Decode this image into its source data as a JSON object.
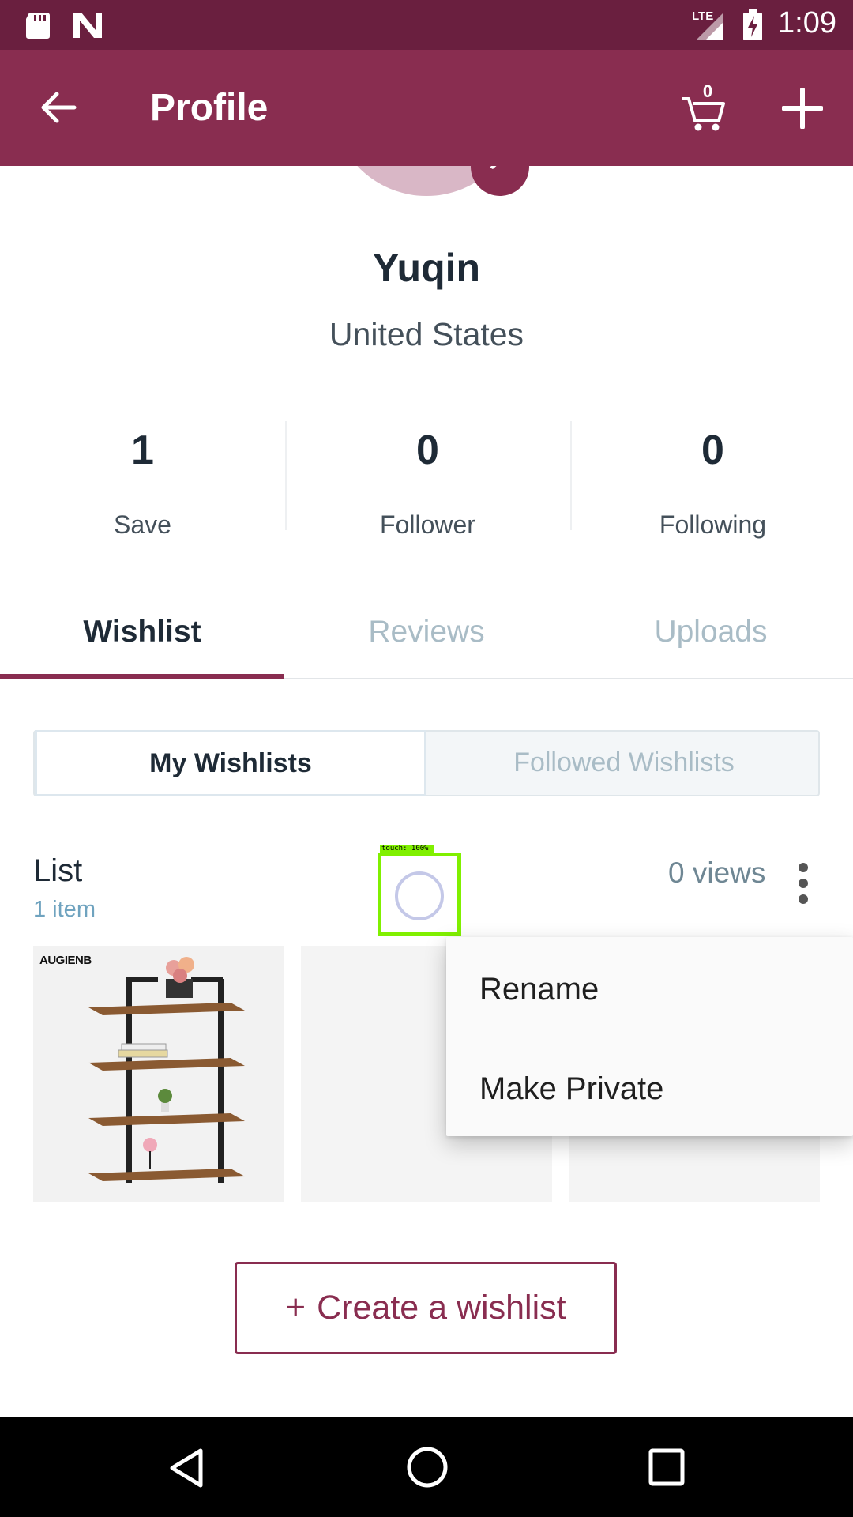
{
  "status_bar": {
    "time": "1:09",
    "network": "LTE",
    "icons": [
      "sd-card-icon",
      "n-icon",
      "signal-icon",
      "battery-charging-icon"
    ]
  },
  "app_bar": {
    "title": "Profile",
    "cart_count": "0",
    "icons": [
      "back-arrow-icon",
      "cart-icon",
      "plus-icon"
    ]
  },
  "profile": {
    "name": "Yuqin",
    "country": "United States"
  },
  "stats": [
    {
      "value": "1",
      "label": "Save"
    },
    {
      "value": "0",
      "label": "Follower"
    },
    {
      "value": "0",
      "label": "Following"
    }
  ],
  "tabs": [
    {
      "label": "Wishlist",
      "active": true
    },
    {
      "label": "Reviews",
      "active": false
    },
    {
      "label": "Uploads",
      "active": false
    }
  ],
  "segments": {
    "my": "My Wishlists",
    "followed": "Followed Wishlists"
  },
  "wishlist": {
    "name": "List",
    "count": "1 item",
    "views": "0 views",
    "thumb_brand": "AUGIENB"
  },
  "touch_indicator": {
    "label": "touch: 100%"
  },
  "menu": {
    "items": [
      "Rename",
      "Make Private"
    ]
  },
  "create_button": {
    "plus": "+",
    "label": "Create a wishlist"
  },
  "colors": {
    "status_bar": "#6a1f3f",
    "app_bar": "#892d50",
    "accent": "#892d50",
    "inactive_tab": "#a9bcc6",
    "count_text": "#6fa3bf"
  }
}
